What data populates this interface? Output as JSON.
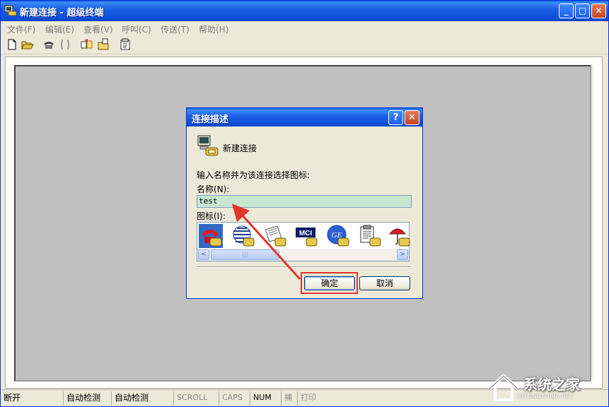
{
  "window": {
    "title": "新建连接 - 超级终端",
    "min_label": "_",
    "max_label": "□",
    "close_label": "✕"
  },
  "menu": [
    {
      "label": "文件(F)"
    },
    {
      "label": "编辑(E)"
    },
    {
      "label": "查看(V)"
    },
    {
      "label": "呼叫(C)"
    },
    {
      "label": "传送(T)"
    },
    {
      "label": "帮助(H)"
    }
  ],
  "toolbar": {
    "icons": [
      "new-file-icon",
      "open-folder-icon",
      "call-icon",
      "disconnect-icon",
      "send-icon",
      "receive-icon",
      "properties-icon"
    ]
  },
  "dialog": {
    "title": "连接描述",
    "help_label": "?",
    "close_label": "✕",
    "heading": "新建连接",
    "prompt": "输入名称并为该连接选择图标:",
    "name_label": "名称(N):",
    "name_value": "test",
    "icon_label": "图标(I):",
    "icons": [
      "red-phone-icon",
      "globe-phone-icon",
      "newspaper-phone-icon",
      "mci-icon",
      "ge-globe-icon",
      "notepad-phone-icon",
      "umbrella-phone-icon"
    ],
    "mci_text": "MCI",
    "ge_text": "GE",
    "ok_label": "确定",
    "cancel_label": "取消",
    "scroll_left": "<",
    "scroll_right": ">",
    "scroll_grip": "|||"
  },
  "status": [
    {
      "label": "断开",
      "dim": false
    },
    {
      "label": "自动检测",
      "dim": false
    },
    {
      "label": "自动检测",
      "dim": false
    },
    {
      "label": "SCROLL",
      "dim": true
    },
    {
      "label": "CAPS",
      "dim": true
    },
    {
      "label": "NUM",
      "dim": false
    },
    {
      "label": "捕",
      "dim": true
    },
    {
      "label": "打印",
      "dim": true
    }
  ],
  "watermark": {
    "text": "系统之家",
    "sub": "XITONGZHIJIA.NET"
  },
  "colors": {
    "titlebar": "#0b4ed6",
    "highlight": "#e2352c",
    "input_bg": "#c7e7d0",
    "terminal_bg": "#c0c0c0"
  }
}
